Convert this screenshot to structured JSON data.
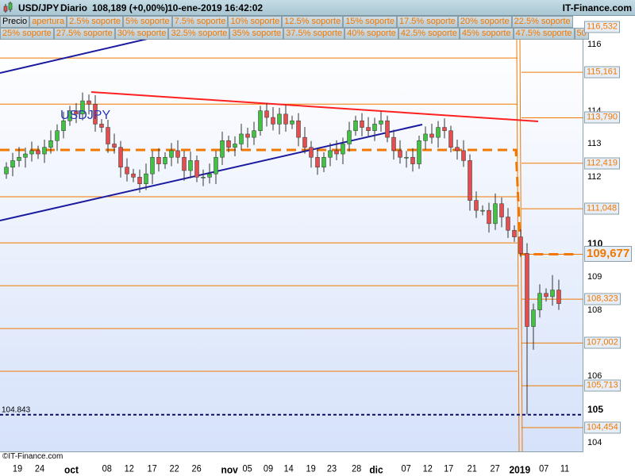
{
  "header": {
    "symbol": "USD/JPY",
    "period": "Diario",
    "price": "108,189 (+0,00%)",
    "datetime": "10-ene-2019 16:42:02",
    "site": "IT-Finance.com"
  },
  "tabs_row1": [
    "Precio",
    "apertura",
    "2.5% soporte",
    "5% soporte",
    "7.5% soporte",
    "10% soporte",
    "12.5% soporte",
    "15% soporte",
    "17.5% soporte",
    "20% soporte",
    "22.5% soporte"
  ],
  "tabs_row2": [
    "25% soporte",
    "27.5% soporte",
    "30% soporte",
    "32.5% soporte",
    "35% soporte",
    "37.5% soporte",
    "40% soporte",
    "42.5% soporte",
    "45% soporte",
    "47.5% soporte",
    "50"
  ],
  "chart_data": {
    "type": "candlestick",
    "symbol_label": "USDJPY",
    "copyright": "©IT-Finance.com",
    "ylim": [
      103.7,
      117.2
    ],
    "y_ticks": [
      {
        "v": 116,
        "t": "116"
      },
      {
        "v": 114,
        "t": "114"
      },
      {
        "v": 113,
        "t": "113"
      },
      {
        "v": 112,
        "t": "112"
      },
      {
        "v": 110,
        "t": "110",
        "bold": true
      },
      {
        "v": 109,
        "t": "109"
      },
      {
        "v": 108,
        "t": "108"
      },
      {
        "v": 106,
        "t": "106"
      },
      {
        "v": 105,
        "t": "105",
        "bold": true
      },
      {
        "v": 104,
        "t": "104"
      }
    ],
    "x_ticks": [
      {
        "i": 1.5,
        "t": "19"
      },
      {
        "i": 5,
        "t": "24"
      },
      {
        "i": 10,
        "t": "oct",
        "bold": true
      },
      {
        "i": 15.6,
        "t": "08"
      },
      {
        "i": 19.1,
        "t": "12"
      },
      {
        "i": 22.7,
        "t": "17"
      },
      {
        "i": 26.2,
        "t": "22"
      },
      {
        "i": 29.7,
        "t": "26"
      },
      {
        "i": 34.9,
        "t": "nov",
        "bold": true
      },
      {
        "i": 37.7,
        "t": "05"
      },
      {
        "i": 41,
        "t": "09"
      },
      {
        "i": 44.2,
        "t": "14"
      },
      {
        "i": 47.7,
        "t": "19"
      },
      {
        "i": 51,
        "t": "23"
      },
      {
        "i": 54.9,
        "t": "28"
      },
      {
        "i": 58,
        "t": "dic",
        "bold": true
      },
      {
        "i": 62.7,
        "t": "07"
      },
      {
        "i": 66.1,
        "t": "12"
      },
      {
        "i": 69.4,
        "t": "17"
      },
      {
        "i": 73.1,
        "t": "21"
      },
      {
        "i": 76.7,
        "t": "27"
      },
      {
        "i": 80.6,
        "t": "2019",
        "bold": true
      },
      {
        "i": 84.4,
        "t": "07"
      },
      {
        "i": 87.7,
        "t": "11"
      }
    ],
    "closes": [
      112.3,
      112.5,
      112.6,
      112.7,
      112.8,
      112.7,
      112.9,
      113.1,
      113.4,
      113.7,
      114.0,
      113.9,
      114.3,
      114.2,
      113.6,
      113.5,
      113.0,
      112.9,
      112.3,
      112.1,
      112.0,
      111.8,
      112.1,
      112.6,
      112.4,
      112.6,
      112.8,
      112.6,
      112.2,
      112.5,
      112.0,
      112.0,
      112.1,
      112.6,
      113.1,
      112.9,
      113.0,
      113.3,
      113.2,
      113.4,
      114.0,
      113.8,
      113.6,
      113.9,
      113.6,
      113.7,
      113.2,
      112.9,
      112.6,
      112.3,
      112.6,
      112.8,
      112.7,
      113.0,
      113.4,
      113.7,
      113.5,
      113.4,
      113.6,
      113.7,
      113.2,
      112.8,
      112.6,
      112.6,
      112.4,
      113.1,
      113.3,
      113.2,
      113.5,
      113.4,
      112.9,
      112.8,
      112.5,
      111.3,
      111.0,
      111.0,
      110.6,
      111.2,
      110.8,
      110.4,
      110.2,
      109.7,
      107.5,
      108.0,
      108.5,
      108.4,
      108.6,
      108.19
    ],
    "open_first": 112.1,
    "low_overrides": [
      {
        "i": 82,
        "low": 104.85
      },
      {
        "i": 81,
        "low": 109.6
      },
      {
        "i": 83,
        "low": 106.8
      }
    ],
    "high_overrides": [
      {
        "i": 12,
        "high": 114.55
      },
      {
        "i": 86,
        "high": 109.05
      }
    ],
    "support_levels": [
      "116,532",
      "115,161",
      "113,790",
      "112,419",
      "111,048",
      "109,677",
      "108,323",
      "107,002",
      "105,713",
      "104,454"
    ],
    "support_values": [
      116.532,
      115.161,
      113.79,
      112.419,
      111.048,
      109.677,
      108.323,
      107.002,
      105.713,
      104.454
    ],
    "prior_levels": [
      115.59,
      114.2,
      112.82,
      111.41,
      110.02,
      108.73,
      107.44,
      106.15,
      103.7
    ],
    "low_marker": "104.843",
    "low_marker_value": 104.843,
    "colors": {
      "up": "#44c044",
      "down": "#e05050",
      "level": "#f07800",
      "trend": "#1a1aa0",
      "resistance": "#ff2020"
    }
  }
}
